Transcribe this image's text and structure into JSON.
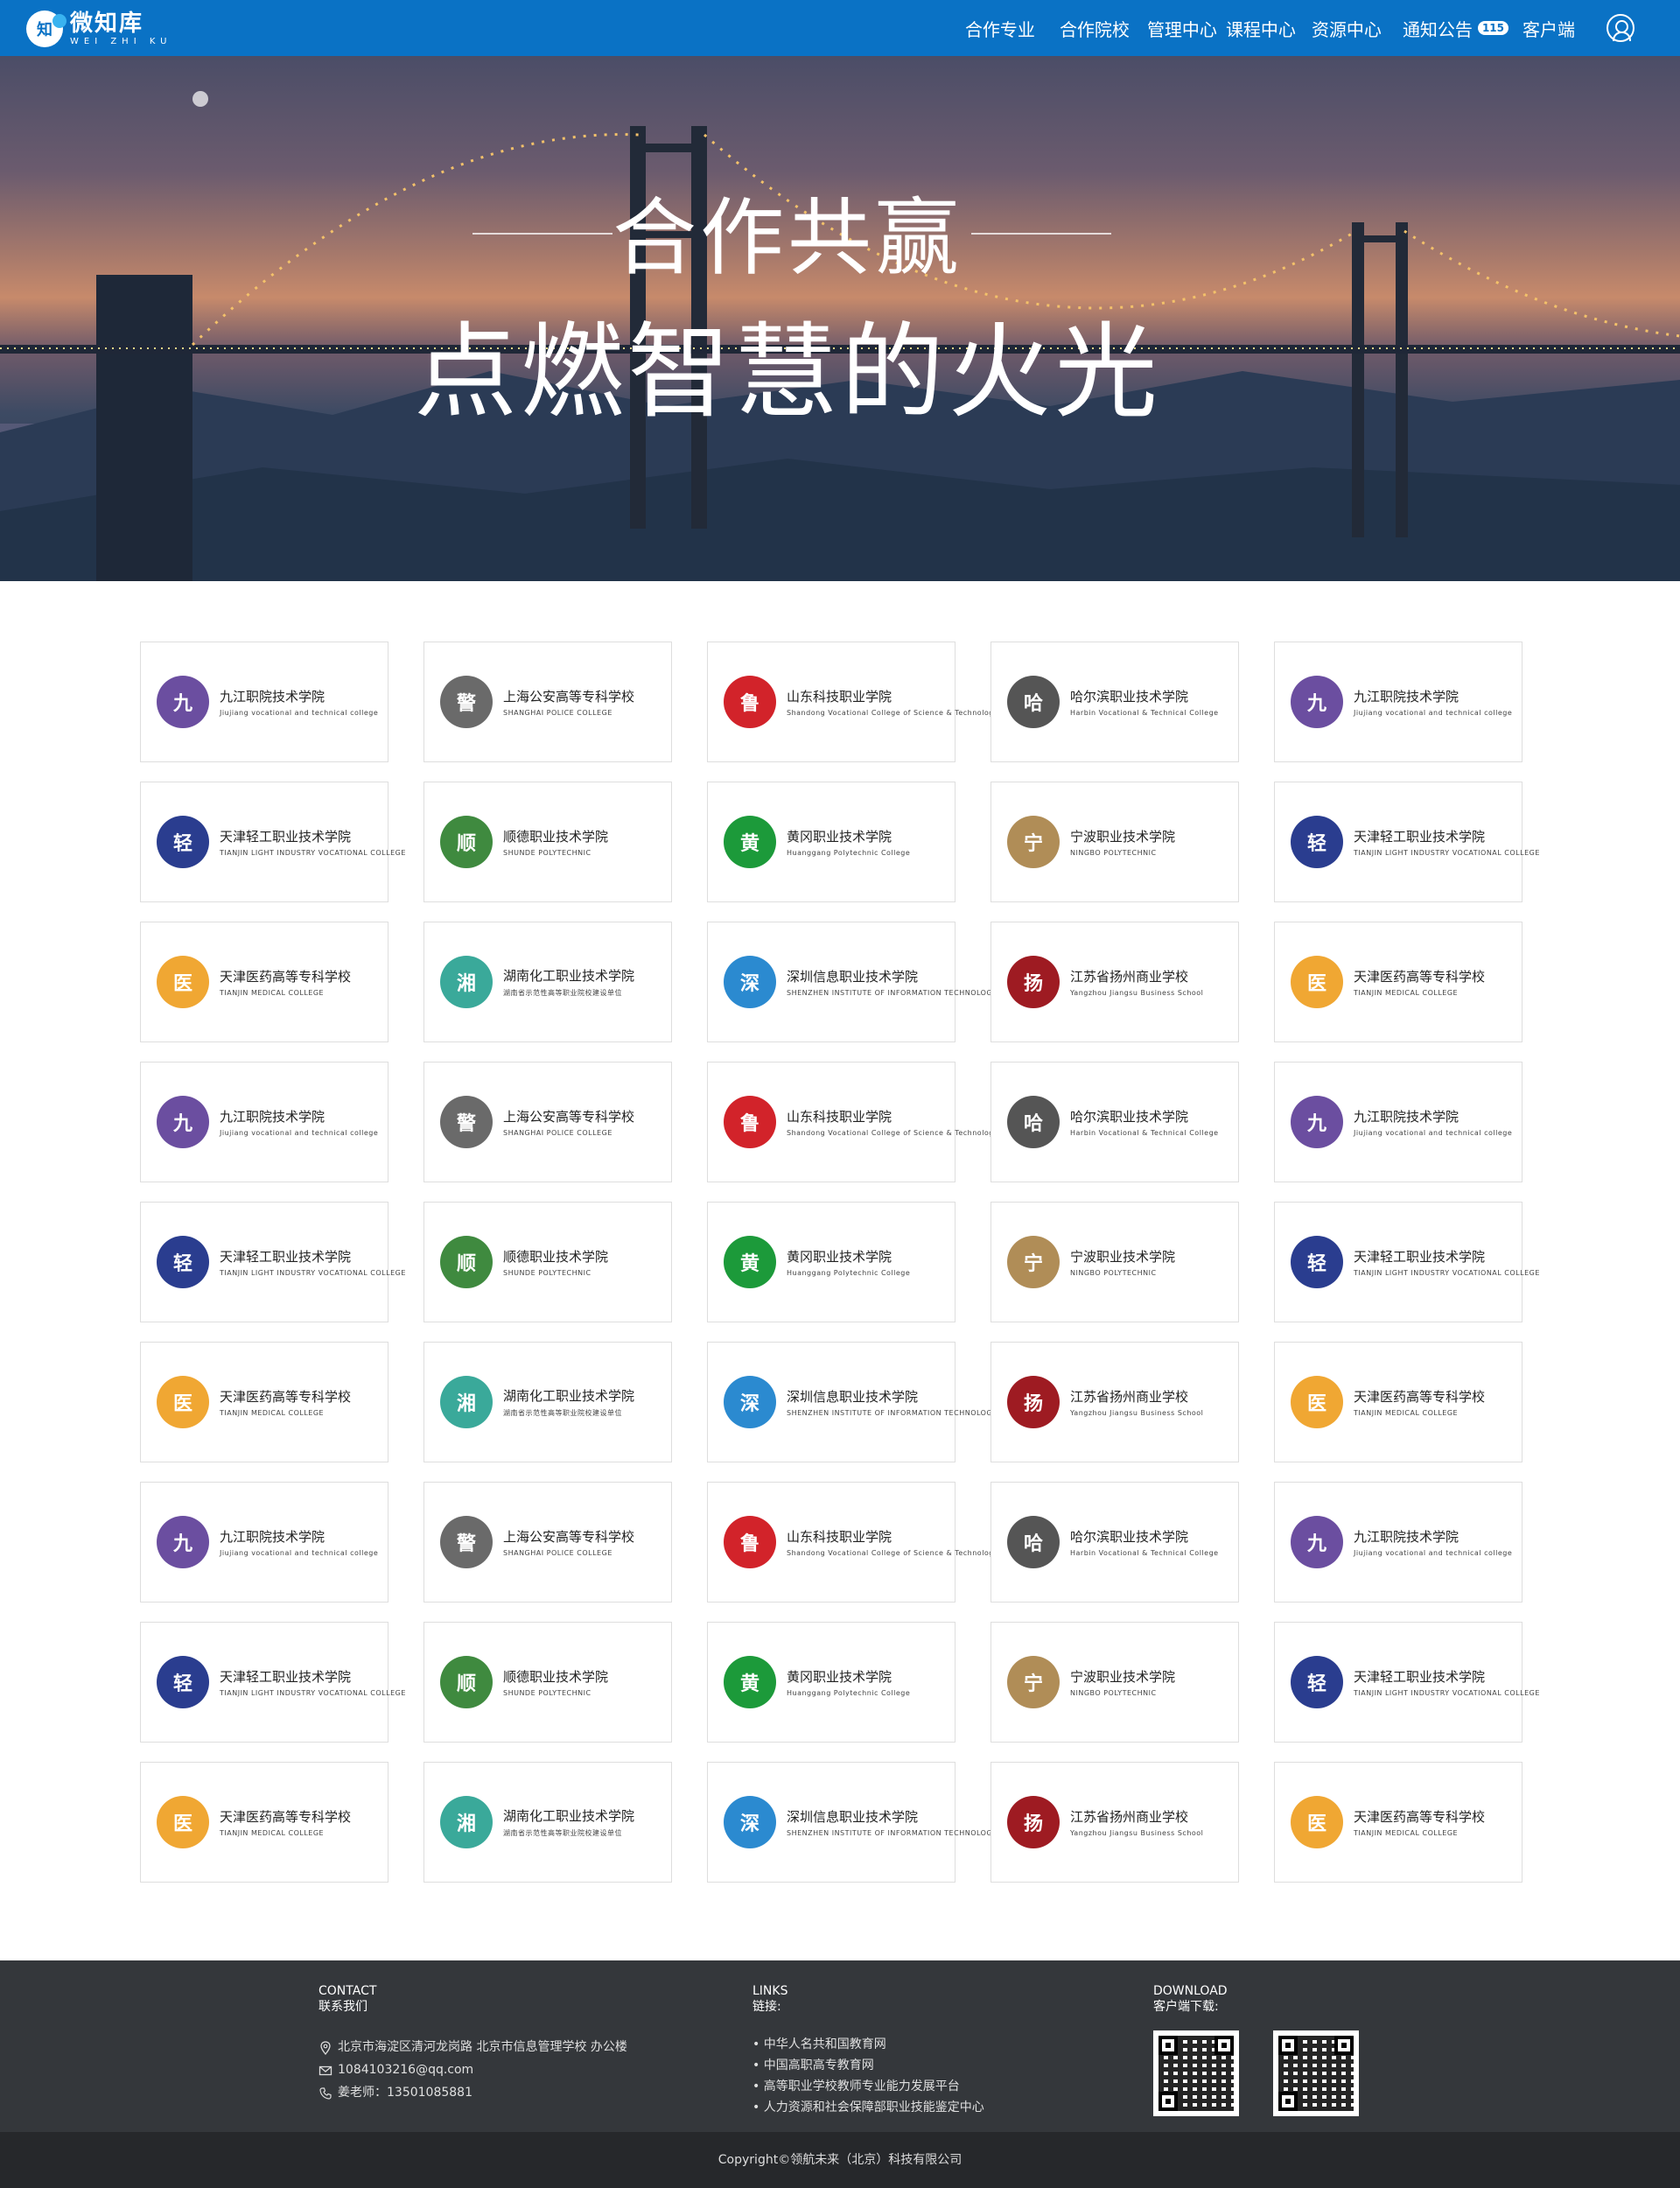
{
  "brand": {
    "title": "微知库",
    "subtitle": "WEI ZHI KU",
    "badge_glyph": "知"
  },
  "nav": {
    "items": [
      "合作专业",
      "合作院校",
      "管理中心",
      "课程中心",
      "资源中心"
    ],
    "notice_label": "通知公告",
    "notice_badge": "115",
    "client_label": "客户端"
  },
  "hero": {
    "title": "合作共赢",
    "subtitle": "点燃智慧的火光"
  },
  "schools": [
    {
      "cn": "九江职院技术学院",
      "en": "Jiujiang vocational and technical college",
      "color": "#6b4ea0",
      "glyph": "九"
    },
    {
      "cn": "上海公安高等专科学校",
      "en": "SHANGHAI POLICE COLLEGE",
      "color": "#6a6a6a",
      "glyph": "警"
    },
    {
      "cn": "山东科技职业学院",
      "en": "Shandong Vocational College of Science & Technology",
      "color": "#d2232a",
      "glyph": "鲁"
    },
    {
      "cn": "哈尔滨职业技术学院",
      "en": "Harbin Vocational & Technical College",
      "color": "#555555",
      "glyph": "哈"
    },
    {
      "cn": "九江职院技术学院",
      "en": "Jiujiang vocational and technical college",
      "color": "#6b4ea0",
      "glyph": "九"
    },
    {
      "cn": "天津轻工职业技术学院",
      "en": "TIANJIN LIGHT INDUSTRY VOCATIONAL COLLEGE",
      "color": "#2a3d8f",
      "glyph": "轻"
    },
    {
      "cn": "顺德职业技术学院",
      "en": "SHUNDE POLYTECHNIC",
      "color": "#3f8a3f",
      "glyph": "顺"
    },
    {
      "cn": "黄冈职业技术学院",
      "en": "Huanggang Polytechnic College",
      "color": "#1c9a3a",
      "glyph": "黄"
    },
    {
      "cn": "宁波职业技术学院",
      "en": "NINGBO POLYTECHNIC",
      "color": "#b08d57",
      "glyph": "宁"
    },
    {
      "cn": "天津轻工职业技术学院",
      "en": "TIANJIN LIGHT INDUSTRY VOCATIONAL COLLEGE",
      "color": "#2a3d8f",
      "glyph": "轻"
    },
    {
      "cn": "天津医药高等专科学校",
      "en": "TIANJIN MEDICAL COLLEGE",
      "color": "#f0a733",
      "glyph": "医"
    },
    {
      "cn": "湖南化工职业技术学院",
      "en": "湖南省示范性高等职业院校建设单位",
      "color": "#3aa99a",
      "glyph": "湘"
    },
    {
      "cn": "深圳信息职业技术学院",
      "en": "SHENZHEN INSTITUTE OF INFORMATION TECHNOLOGY",
      "color": "#2b8ad0",
      "glyph": "深"
    },
    {
      "cn": "江苏省扬州商业学校",
      "en": "Yangzhou Jiangsu Business School",
      "color": "#9e1b22",
      "glyph": "扬"
    },
    {
      "cn": "天津医药高等专科学校",
      "en": "TIANJIN MEDICAL COLLEGE",
      "color": "#f0a733",
      "glyph": "医"
    },
    {
      "cn": "九江职院技术学院",
      "en": "Jiujiang vocational and technical college",
      "color": "#6b4ea0",
      "glyph": "九"
    },
    {
      "cn": "上海公安高等专科学校",
      "en": "SHANGHAI POLICE COLLEGE",
      "color": "#6a6a6a",
      "glyph": "警"
    },
    {
      "cn": "山东科技职业学院",
      "en": "Shandong Vocational College of Science & Technology",
      "color": "#d2232a",
      "glyph": "鲁"
    },
    {
      "cn": "哈尔滨职业技术学院",
      "en": "Harbin Vocational & Technical College",
      "color": "#555555",
      "glyph": "哈"
    },
    {
      "cn": "九江职院技术学院",
      "en": "Jiujiang vocational and technical college",
      "color": "#6b4ea0",
      "glyph": "九"
    },
    {
      "cn": "天津轻工职业技术学院",
      "en": "TIANJIN LIGHT INDUSTRY VOCATIONAL COLLEGE",
      "color": "#2a3d8f",
      "glyph": "轻"
    },
    {
      "cn": "顺德职业技术学院",
      "en": "SHUNDE POLYTECHNIC",
      "color": "#3f8a3f",
      "glyph": "顺"
    },
    {
      "cn": "黄冈职业技术学院",
      "en": "Huanggang Polytechnic College",
      "color": "#1c9a3a",
      "glyph": "黄"
    },
    {
      "cn": "宁波职业技术学院",
      "en": "NINGBO POLYTECHNIC",
      "color": "#b08d57",
      "glyph": "宁"
    },
    {
      "cn": "天津轻工职业技术学院",
      "en": "TIANJIN LIGHT INDUSTRY VOCATIONAL COLLEGE",
      "color": "#2a3d8f",
      "glyph": "轻"
    },
    {
      "cn": "天津医药高等专科学校",
      "en": "TIANJIN MEDICAL COLLEGE",
      "color": "#f0a733",
      "glyph": "医"
    },
    {
      "cn": "湖南化工职业技术学院",
      "en": "湖南省示范性高等职业院校建设单位",
      "color": "#3aa99a",
      "glyph": "湘"
    },
    {
      "cn": "深圳信息职业技术学院",
      "en": "SHENZHEN INSTITUTE OF INFORMATION TECHNOLOGY",
      "color": "#2b8ad0",
      "glyph": "深"
    },
    {
      "cn": "江苏省扬州商业学校",
      "en": "Yangzhou Jiangsu Business School",
      "color": "#9e1b22",
      "glyph": "扬"
    },
    {
      "cn": "天津医药高等专科学校",
      "en": "TIANJIN MEDICAL COLLEGE",
      "color": "#f0a733",
      "glyph": "医"
    },
    {
      "cn": "九江职院技术学院",
      "en": "Jiujiang vocational and technical college",
      "color": "#6b4ea0",
      "glyph": "九"
    },
    {
      "cn": "上海公安高等专科学校",
      "en": "SHANGHAI POLICE COLLEGE",
      "color": "#6a6a6a",
      "glyph": "警"
    },
    {
      "cn": "山东科技职业学院",
      "en": "Shandong Vocational College of Science & Technology",
      "color": "#d2232a",
      "glyph": "鲁"
    },
    {
      "cn": "哈尔滨职业技术学院",
      "en": "Harbin Vocational & Technical College",
      "color": "#555555",
      "glyph": "哈"
    },
    {
      "cn": "九江职院技术学院",
      "en": "Jiujiang vocational and technical college",
      "color": "#6b4ea0",
      "glyph": "九"
    },
    {
      "cn": "天津轻工职业技术学院",
      "en": "TIANJIN LIGHT INDUSTRY VOCATIONAL COLLEGE",
      "color": "#2a3d8f",
      "glyph": "轻"
    },
    {
      "cn": "顺德职业技术学院",
      "en": "SHUNDE POLYTECHNIC",
      "color": "#3f8a3f",
      "glyph": "顺"
    },
    {
      "cn": "黄冈职业技术学院",
      "en": "Huanggang Polytechnic College",
      "color": "#1c9a3a",
      "glyph": "黄"
    },
    {
      "cn": "宁波职业技术学院",
      "en": "NINGBO POLYTECHNIC",
      "color": "#b08d57",
      "glyph": "宁"
    },
    {
      "cn": "天津轻工职业技术学院",
      "en": "TIANJIN LIGHT INDUSTRY VOCATIONAL COLLEGE",
      "color": "#2a3d8f",
      "glyph": "轻"
    },
    {
      "cn": "天津医药高等专科学校",
      "en": "TIANJIN MEDICAL COLLEGE",
      "color": "#f0a733",
      "glyph": "医"
    },
    {
      "cn": "湖南化工职业技术学院",
      "en": "湖南省示范性高等职业院校建设单位",
      "color": "#3aa99a",
      "glyph": "湘"
    },
    {
      "cn": "深圳信息职业技术学院",
      "en": "SHENZHEN INSTITUTE OF INFORMATION TECHNOLOGY",
      "color": "#2b8ad0",
      "glyph": "深"
    },
    {
      "cn": "江苏省扬州商业学校",
      "en": "Yangzhou Jiangsu Business School",
      "color": "#9e1b22",
      "glyph": "扬"
    },
    {
      "cn": "天津医药高等专科学校",
      "en": "TIANJIN MEDICAL COLLEGE",
      "color": "#f0a733",
      "glyph": "医"
    }
  ],
  "footer": {
    "contact": {
      "heading": "CONTACT",
      "subheading": "联系我们",
      "address": "北京市海淀区清河龙岗路 北京市信息管理学校 办公楼",
      "email": "1084103216@qq.com",
      "phone": "姜老师：13501085881"
    },
    "links": {
      "heading": "LINKS",
      "subheading": "链接:",
      "items": [
        "• 中华人名共和国教育网",
        "• 中国高职高专教育网",
        "• 高等职业学校教师专业能力发展平台",
        "• 人力资源和社会保障部职业技能鉴定中心"
      ]
    },
    "download": {
      "heading": "DOWNLOAD",
      "subheading": "客户端下载:"
    },
    "copyright": "Copyright©领航未来（北京）科技有限公司"
  }
}
